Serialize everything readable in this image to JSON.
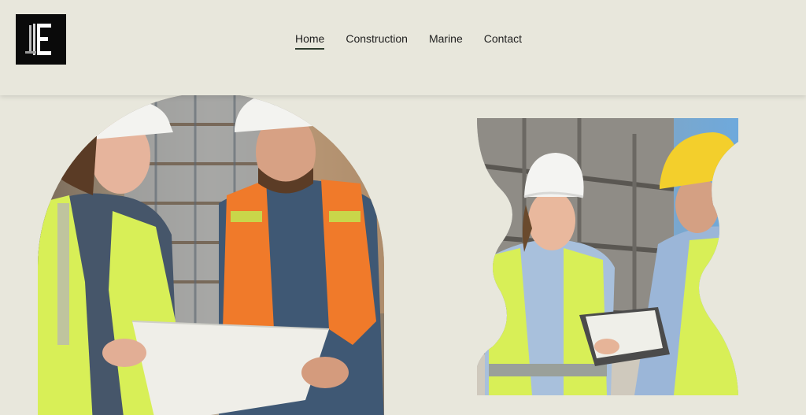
{
  "header": {
    "logo": {
      "letter": "E",
      "icon": "logo-e-icon",
      "background": "#0a0a0a",
      "foreground": "#ffffff"
    },
    "nav": [
      {
        "label": "Home",
        "active": true
      },
      {
        "label": "Construction",
        "active": false
      },
      {
        "label": "Marine",
        "active": false
      },
      {
        "label": "Contact",
        "active": false
      }
    ]
  },
  "colors": {
    "background": "#e8e7dc",
    "nav_text": "#1f1f1f",
    "active_underline": "#2f3d2f"
  },
  "images": {
    "left": {
      "subject": "two construction workers in hard hats and safety vests reviewing blueprints",
      "shape": "arch"
    },
    "right": {
      "subject": "two construction workers with clipboard at a building site",
      "shape": "wavy-cutout"
    }
  }
}
